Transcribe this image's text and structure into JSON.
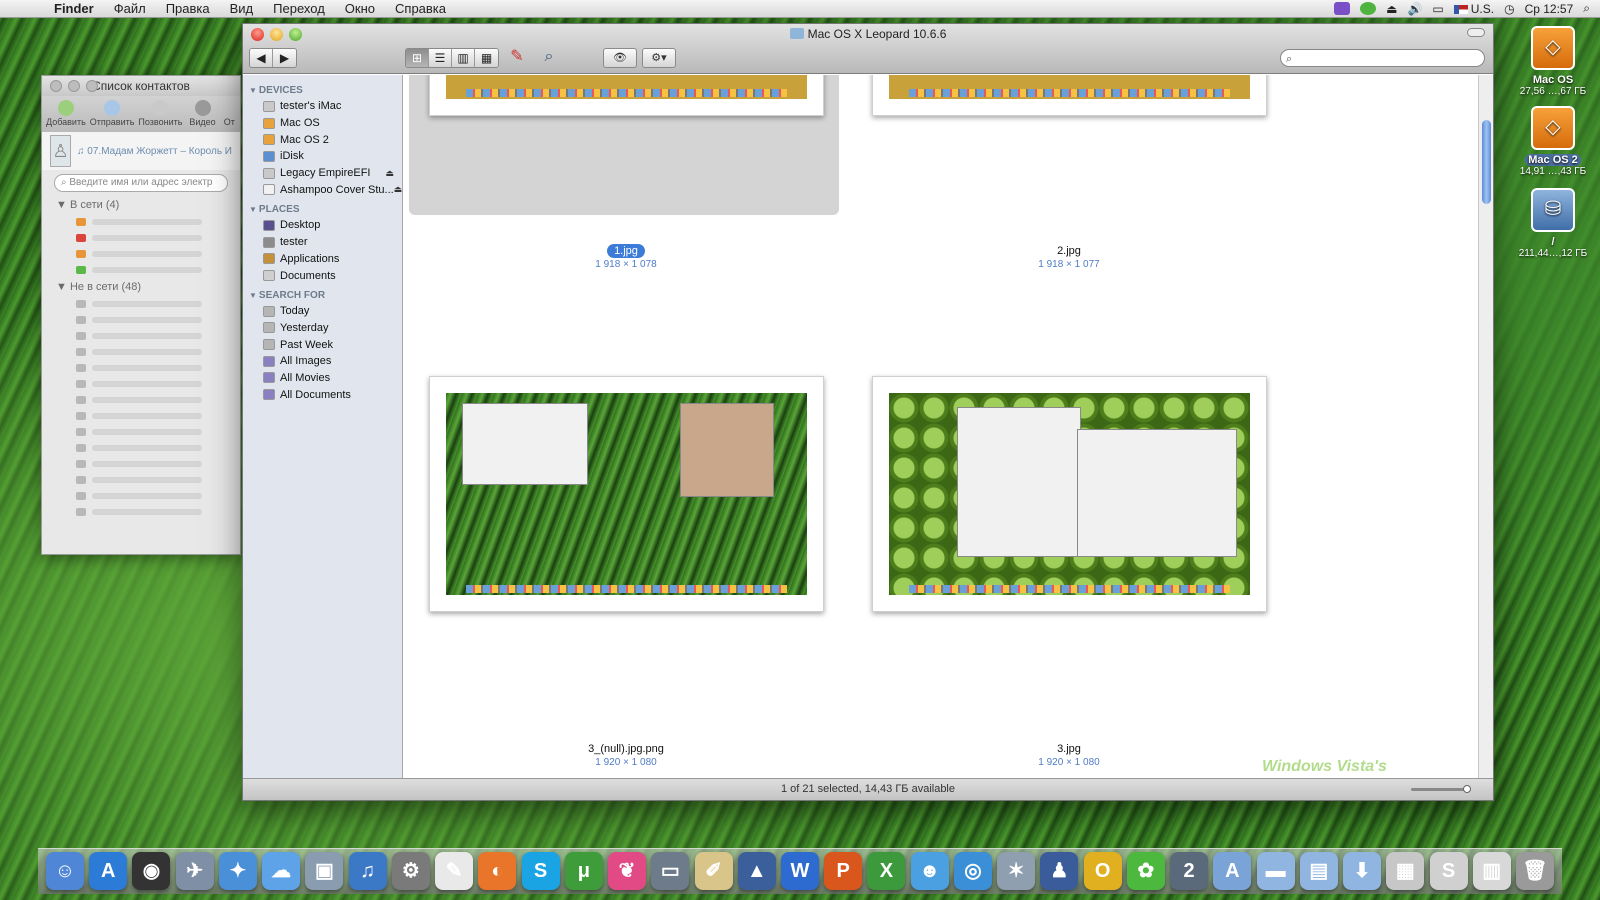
{
  "menubar": {
    "apple_glyph": "",
    "items": [
      "Finder",
      "Файл",
      "Правка",
      "Вид",
      "Переход",
      "Окно",
      "Справка"
    ],
    "input_source": "U.S.",
    "clock": "Ср 12:57"
  },
  "contacts": {
    "title": "Список контактов",
    "tools": [
      "Добавить",
      "Отправить",
      "Позвонить",
      "Видео",
      "От"
    ],
    "status_song": "♫ 07.Мадам Жоржетт – Король И",
    "search_placeholder": "Введите имя или адрес электр",
    "groups": [
      {
        "label": "В сети (4)",
        "colors": [
          "#e8953a",
          "#d9453a",
          "#e8953a",
          "#5cb848"
        ]
      },
      {
        "label": "Не в сети (48)",
        "count": 14,
        "color": "#b8b8b8"
      }
    ]
  },
  "finder": {
    "title": "Mac OS X Leopard 10.6.6",
    "search_placeholder": "",
    "view_modes": [
      "⊞",
      "☰",
      "▥",
      "▦"
    ],
    "sidebar": [
      {
        "header": "DEVICES",
        "items": [
          {
            "label": "tester's iMac",
            "color": "#c9c9c9"
          },
          {
            "label": "Mac OS",
            "color": "#e7a23b"
          },
          {
            "label": "Mac OS 2",
            "color": "#e7a23b"
          },
          {
            "label": "iDisk",
            "color": "#5c8fd1"
          },
          {
            "label": "Legacy EmpireEFI",
            "color": "#c9c9c9",
            "eject": "⏏"
          },
          {
            "label": "Ashampoo Cover Stu...",
            "color": "#f1f1f1",
            "eject": "⏏"
          }
        ]
      },
      {
        "header": "PLACES",
        "items": [
          {
            "label": "Desktop",
            "color": "#5a4f8f"
          },
          {
            "label": "tester",
            "color": "#8c8c8c"
          },
          {
            "label": "Applications",
            "color": "#c4903a"
          },
          {
            "label": "Documents",
            "color": "#cfcfcf"
          }
        ]
      },
      {
        "header": "SEARCH FOR",
        "items": [
          {
            "label": "Today",
            "color": "#b5b5b5"
          },
          {
            "label": "Yesterday",
            "color": "#b5b5b5"
          },
          {
            "label": "Past Week",
            "color": "#b5b5b5"
          },
          {
            "label": "All Images",
            "color": "#8a7fc0"
          },
          {
            "label": "All Movies",
            "color": "#8a7fc0"
          },
          {
            "label": "All Documents",
            "color": "#8a7fc0"
          }
        ]
      }
    ],
    "files": [
      {
        "name": "1.jpg",
        "dims": "1 918 × 1 078",
        "selected": true
      },
      {
        "name": "2.jpg",
        "dims": "1 918 × 1 077",
        "selected": false
      },
      {
        "name": "3_(null).jpg.png",
        "dims": "1 920 × 1 080",
        "selected": false
      },
      {
        "name": "3.jpg",
        "dims": "1 920 × 1 080",
        "selected": false
      }
    ],
    "status": "1 of 21 selected, 14,43 ГБ available"
  },
  "desktop_icons": [
    {
      "name": "Mac OS",
      "size": "27,56 …,67 ГБ",
      "glyph": "◇",
      "selected": false
    },
    {
      "name": "Mac OS 2",
      "size": "14,91 …,43 ГБ",
      "glyph": "◇",
      "selected": true
    },
    {
      "name": "/",
      "size": "211,44…,12 ГБ",
      "glyph": "⛁",
      "selected": false
    }
  ],
  "watermark": "Windows Vista's",
  "dock": [
    {
      "name": "finder",
      "glyph": "☺",
      "color": "#4f86d6"
    },
    {
      "name": "app-store",
      "glyph": "A",
      "color": "#2c7bd6"
    },
    {
      "name": "dashboard",
      "glyph": "◉",
      "color": "#333333"
    },
    {
      "name": "mail",
      "glyph": "✈",
      "color": "#7f8fa6"
    },
    {
      "name": "safari",
      "glyph": "✦",
      "color": "#4a90d9"
    },
    {
      "name": "ichat",
      "glyph": "☁",
      "color": "#5ea3e8"
    },
    {
      "name": "iphoto",
      "glyph": "▣",
      "color": "#8a9db0"
    },
    {
      "name": "itunes",
      "glyph": "♫",
      "color": "#3b79c6"
    },
    {
      "name": "system-preferences",
      "glyph": "⚙",
      "color": "#7a7a7a"
    },
    {
      "name": "textedit",
      "glyph": "✎",
      "color": "#e9e9e9"
    },
    {
      "name": "firefox",
      "glyph": "◐",
      "color": "#e8752a"
    },
    {
      "name": "skype",
      "glyph": "S",
      "color": "#1aa4e3"
    },
    {
      "name": "utorrent",
      "glyph": "μ",
      "color": "#3e9c3a"
    },
    {
      "name": "pink-app",
      "glyph": "❦",
      "color": "#e24a86"
    },
    {
      "name": "preview",
      "glyph": "▭",
      "color": "#6d7b8a"
    },
    {
      "name": "pages",
      "glyph": "✐",
      "color": "#d9c48a"
    },
    {
      "name": "keynote",
      "glyph": "▲",
      "color": "#3a5f9a"
    },
    {
      "name": "word",
      "glyph": "W",
      "color": "#2d6bd0"
    },
    {
      "name": "powerpoint",
      "glyph": "P",
      "color": "#d9571c"
    },
    {
      "name": "excel",
      "glyph": "X",
      "color": "#3c9a3c"
    },
    {
      "name": "messenger",
      "glyph": "☻",
      "color": "#4aa0e0"
    },
    {
      "name": "download-globe",
      "glyph": "◎",
      "color": "#3a8fd6"
    },
    {
      "name": "network-utility",
      "glyph": "✶",
      "color": "#8f9fb0"
    },
    {
      "name": "agent",
      "glyph": "♟",
      "color": "#3b5c9a"
    },
    {
      "name": "opera",
      "glyph": "O",
      "color": "#e0b020"
    },
    {
      "name": "icq",
      "glyph": "✿",
      "color": "#4db83e"
    },
    {
      "name": "tv-app",
      "glyph": "2",
      "color": "#5a6a7a"
    },
    {
      "name": "applications-stack",
      "glyph": "A",
      "color": "#7aa4d8"
    },
    {
      "name": "folder-stack",
      "glyph": "▬",
      "color": "#8fb5e0"
    },
    {
      "name": "documents-stack",
      "glyph": "▤",
      "color": "#8fb5e0"
    },
    {
      "name": "downloads-stack",
      "glyph": "⬇",
      "color": "#8fb5e0"
    },
    {
      "name": "stack-screenshot",
      "glyph": "▦",
      "color": "#c7c7c7"
    },
    {
      "name": "stack-skype",
      "glyph": "S",
      "color": "#d0d0d0"
    },
    {
      "name": "stack-firefox",
      "glyph": "▥",
      "color": "#d8d8d8"
    },
    {
      "name": "trash",
      "glyph": "🗑",
      "color": "#9a9a9a"
    }
  ]
}
